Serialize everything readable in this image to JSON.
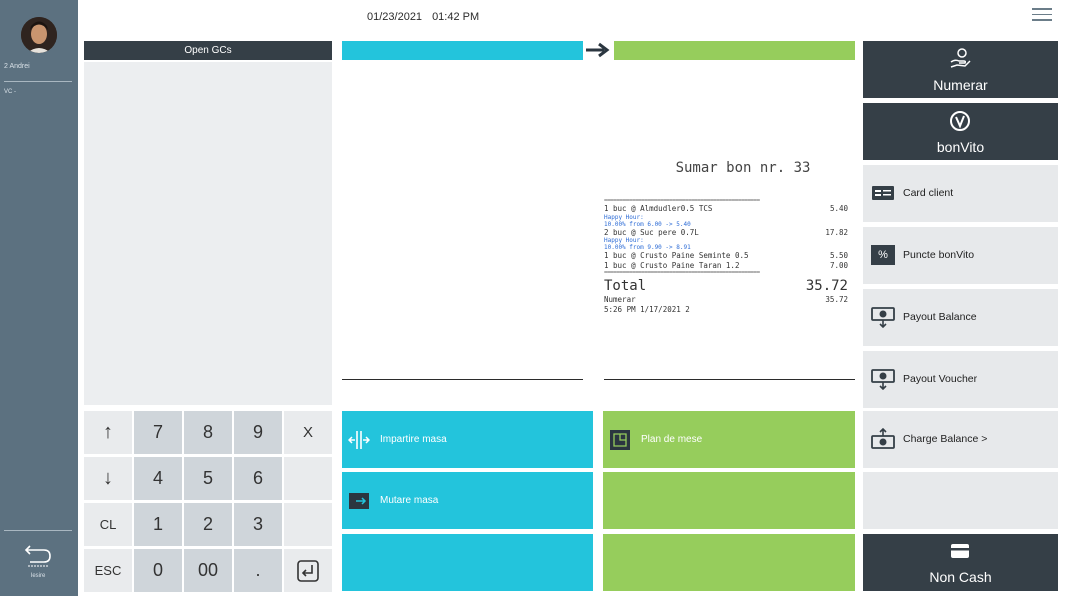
{
  "sidebar": {
    "user": "2 Andrei",
    "vc": "VC -",
    "exit_label": "Iesire"
  },
  "header": {
    "date": "01/23/2021",
    "time": "01:42 PM"
  },
  "open_gcs": {
    "title": "Open GCs"
  },
  "keypad": {
    "up": "↑",
    "down": "↓",
    "clear": "CL",
    "escape": "ESC",
    "k7": "7",
    "k8": "8",
    "k9": "9",
    "multiply": "X",
    "k4": "4",
    "k5": "5",
    "k6": "6",
    "k1": "1",
    "k2": "2",
    "k3": "3",
    "k0": "0",
    "k00": "00",
    "dot": ".",
    "enter": "⏎"
  },
  "receipt": {
    "title": "Sumar bon nr. 33",
    "separator": "==================================================",
    "lines": [
      {
        "text": "1 buc @ Almdudler0.5 TCS",
        "amount": "5.40"
      },
      {
        "text": "Happy Hour:",
        "amount": "",
        "note": true
      },
      {
        "text": "10.00% from 6.00 -> 5.40",
        "amount": "",
        "note": true
      },
      {
        "text": "2 buc @ Suc pere 0.7L",
        "amount": "17.82"
      },
      {
        "text": "Happy Hour:",
        "amount": "",
        "note": true
      },
      {
        "text": "10.00% from 9.90 -> 8.91",
        "amount": "",
        "note": true
      },
      {
        "text": "1 buc @ Crusto Paine Seminte 0.5",
        "amount": "5.50"
      },
      {
        "text": "1 buc @ Crusto Paine Taran 1.2",
        "amount": "7.00"
      }
    ],
    "total_label": "Total",
    "total_amount": "35.72",
    "payment_label": "Numerar",
    "payment_amount": "35.72",
    "timestamp": "5:26 PM 1/17/2021 2"
  },
  "actions": {
    "split_table": "Impartire masa",
    "move_table": "Mutare masa",
    "table_plan": "Plan de mese"
  },
  "payments": {
    "cash": "Numerar",
    "bonvito": "bonVito",
    "client_card": "Card client",
    "bonvito_points": "Puncte bonVito",
    "percent_badge": "%",
    "payout_balance": "Payout Balance",
    "payout_voucher": "Payout Voucher",
    "charge_balance": "Charge Balance >",
    "non_cash": "Non Cash"
  },
  "colors": {
    "rail": "#5c7180",
    "dark": "#353f47",
    "cyan": "#23c4dc",
    "green": "#96cd5c",
    "light": "#e7e9eb"
  }
}
